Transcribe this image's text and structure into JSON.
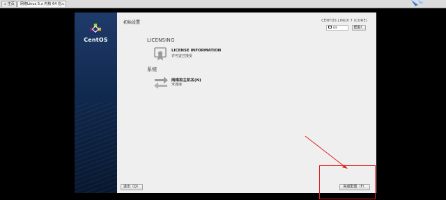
{
  "host": {
    "tabs": [
      {
        "label": "主页"
      },
      {
        "label": "网络Linux 5.x 内核 64 位..."
      }
    ],
    "tab_close": "×"
  },
  "installer": {
    "logo_text": "CentOS",
    "page_title": "初始设置",
    "product": "CENTOS LINUX 7 (CORE)",
    "keyboard_layout": "us",
    "help_label": "帮助！",
    "sections": [
      {
        "heading": "LICENSING",
        "spokes": [
          {
            "title": "LICENSE INFORMATION",
            "status": "许可证已接受",
            "icon": "license-certificate-icon"
          }
        ]
      },
      {
        "heading": "系统",
        "spokes": [
          {
            "title": "网络和主机名(N)",
            "status": "未连接",
            "icon": "network-arrows-icon"
          }
        ]
      }
    ],
    "quit_label": "退出（Q）",
    "finish_label": "完成配置（F）"
  },
  "annotation": {
    "color": "#e0211d"
  }
}
